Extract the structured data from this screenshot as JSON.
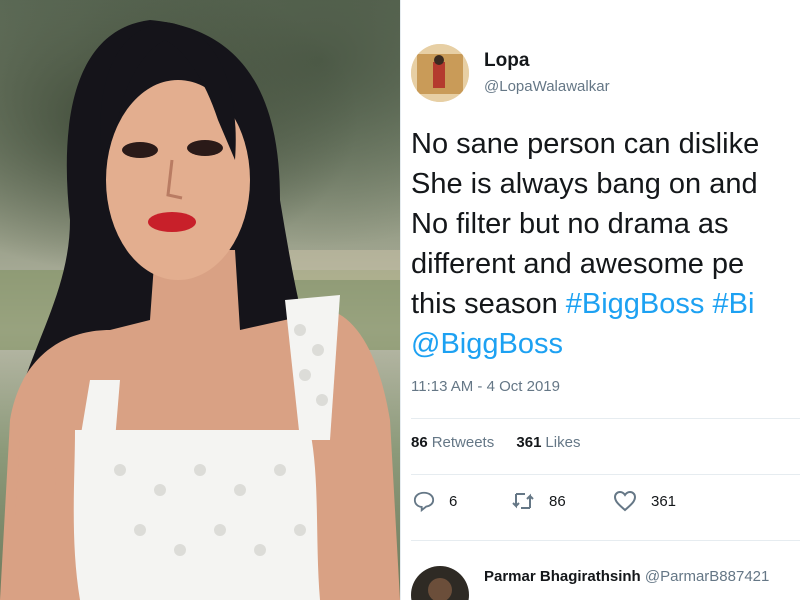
{
  "tweet": {
    "name": "Lopa",
    "handle": "@LopaWalawalkar",
    "lines": [
      {
        "text": "No sane person can dislike",
        "hashtags": []
      },
      {
        "text": "She is always bang on and",
        "hashtags": []
      },
      {
        "text": "No filter but no drama as",
        "hashtags": []
      },
      {
        "text": "different and awesome pe",
        "hashtags": []
      },
      {
        "text": "this season ",
        "hashtags": [
          "#BiggBoss",
          "#Bi"
        ]
      },
      {
        "text": "",
        "hashtags": [
          "@BiggBoss"
        ]
      }
    ],
    "timestamp": "11:13 AM - 4 Oct 2019",
    "retweets_count": "86",
    "retweets_label": "Retweets",
    "likes_count": "361",
    "likes_label": "Likes",
    "actions": {
      "reply_count": "6",
      "retweet_count": "86",
      "like_count": "361"
    }
  },
  "reply": {
    "name": "Parmar Bhagirathsinh",
    "handle": "@ParmarB887421"
  },
  "colors": {
    "link": "#1da1f2",
    "text": "#14171a",
    "muted": "#657786",
    "divider": "#e6ecf0"
  }
}
